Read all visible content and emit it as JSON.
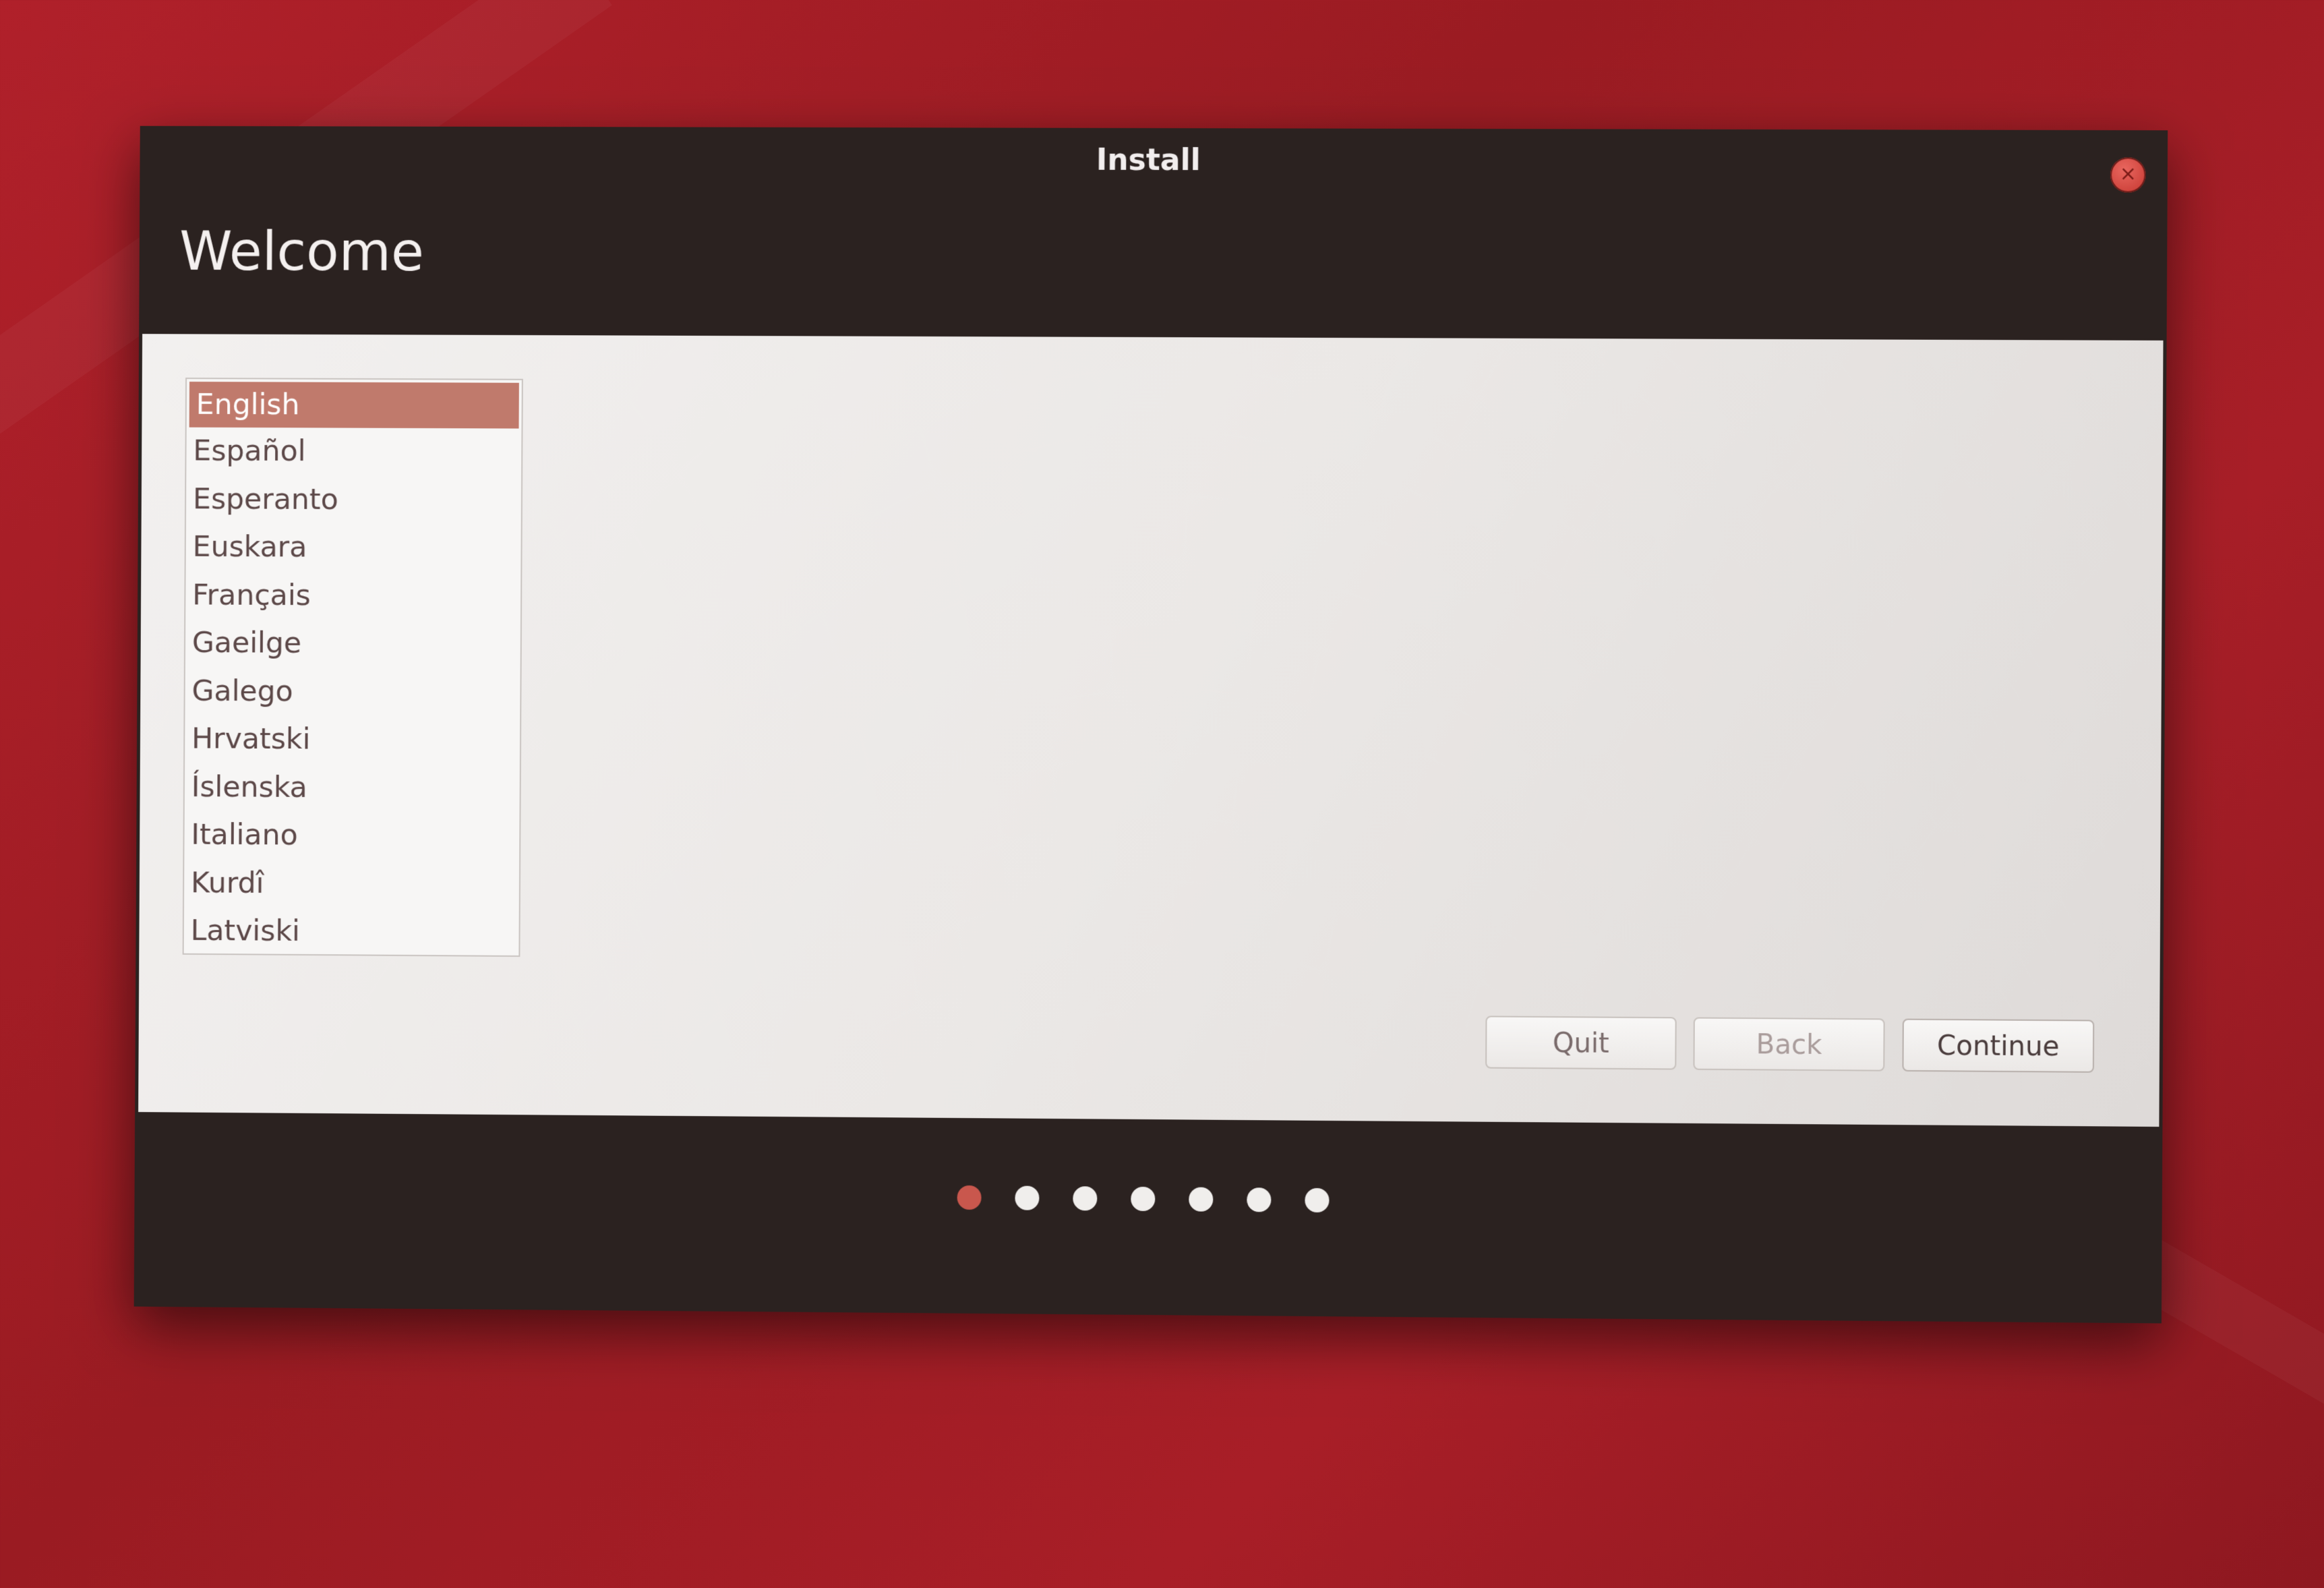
{
  "window": {
    "title": "Install",
    "close_icon": "close-icon",
    "heading": "Welcome"
  },
  "languages": {
    "items": [
      {
        "label": "English",
        "selected": true
      },
      {
        "label": "Español",
        "selected": false
      },
      {
        "label": "Esperanto",
        "selected": false
      },
      {
        "label": "Euskara",
        "selected": false
      },
      {
        "label": "Français",
        "selected": false
      },
      {
        "label": "Gaeilge",
        "selected": false
      },
      {
        "label": "Galego",
        "selected": false
      },
      {
        "label": "Hrvatski",
        "selected": false
      },
      {
        "label": "Íslenska",
        "selected": false
      },
      {
        "label": "Italiano",
        "selected": false
      },
      {
        "label": "Kurdî",
        "selected": false
      },
      {
        "label": "Latviski",
        "selected": false
      }
    ]
  },
  "buttons": {
    "quit": "Quit",
    "back": "Back",
    "continue": "Continue"
  },
  "progress": {
    "total_steps": 7,
    "current_step": 1
  },
  "colors": {
    "accent": "#c07a6c",
    "active_dot": "#c9574d",
    "titlebar": "#2b2220",
    "desktop": "#a81e27"
  }
}
